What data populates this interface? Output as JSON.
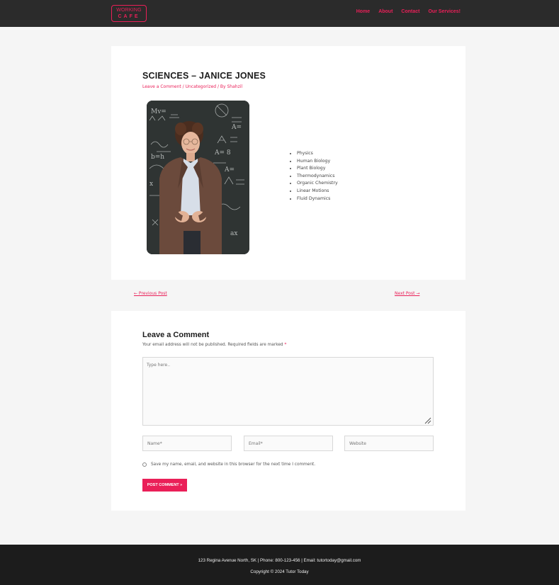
{
  "header": {
    "logo_line1": "WORKING",
    "logo_line2": "CAFE",
    "nav": [
      "Home",
      "About",
      "Contact",
      "Our Services!"
    ]
  },
  "article": {
    "title": "SCIENCES – JANICE JONES",
    "meta": {
      "comment_link": "Leave a Comment",
      "sep1": " / ",
      "category": "Uncategorized",
      "sep2": " / By ",
      "author": "Shahzil"
    },
    "subjects": [
      "Physics",
      "Human Biology",
      "Plant Biology",
      "Thermodynamics",
      "Organic Chemistry",
      "Linear Motions",
      "Fluid Dynamics"
    ]
  },
  "post_nav": {
    "previous": "← Previous Post",
    "next": "Next Post →"
  },
  "comment_form": {
    "title": "Leave a Comment",
    "note": "Your email address will not be published. Required fields are marked ",
    "required_mark": "*",
    "textarea_placeholder": "Type here..",
    "name_placeholder": "Name*",
    "email_placeholder": "Email*",
    "website_placeholder": "Website",
    "consent_text": "Save my name, email, and website in this browser for the next time I comment.",
    "submit_label": "POST COMMENT »"
  },
  "footer": {
    "contact": "123 Regina Avenue North, SK | Phone: 800-123-456 | Email: tutortoday@gmail.com",
    "copyright": "Copyright © 2024 Tutor Today"
  },
  "colors": {
    "accent": "#ea1f58",
    "header_bg": "#2b2b2b",
    "footer_bg": "#1c1c1c"
  }
}
